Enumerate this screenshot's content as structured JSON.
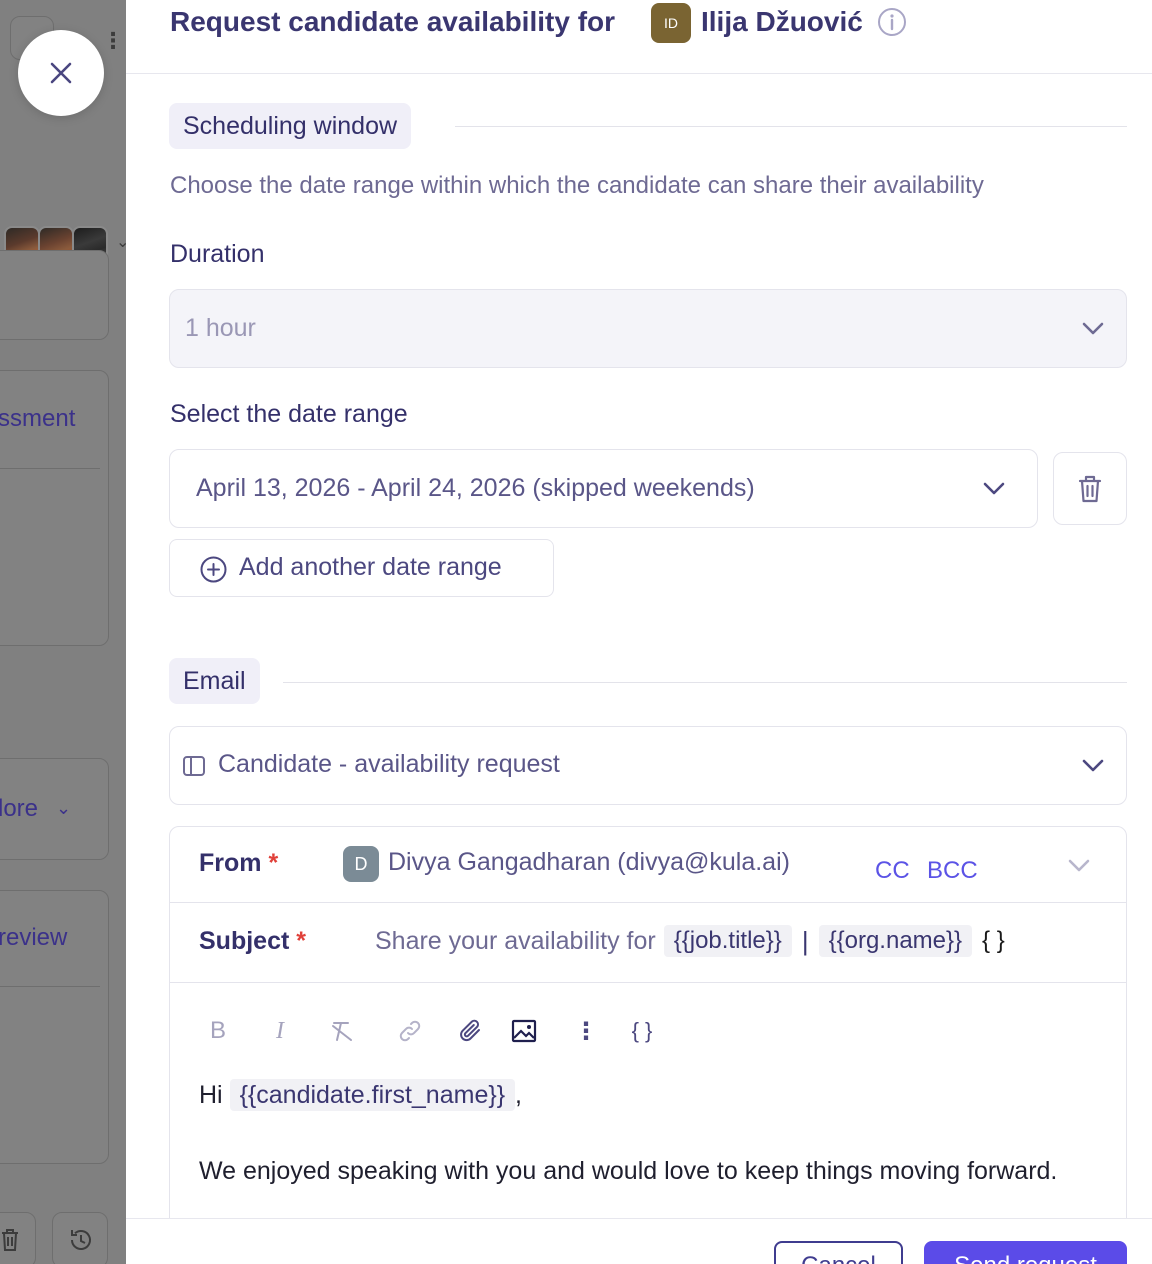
{
  "background": {
    "visible_labels": [
      "ssment",
      "lore",
      "review"
    ]
  },
  "header": {
    "title": "Request candidate availability for",
    "candidate_initials": "ID",
    "candidate_name": "Ilija Džuović"
  },
  "scheduling": {
    "section_label": "Scheduling window",
    "description": "Choose the date range within which the candidate can share their availability",
    "duration_label": "Duration",
    "duration_value": "1 hour",
    "date_range_label": "Select the date range",
    "date_range_value": "April 13, 2026 - April 24, 2026 (skipped weekends)",
    "add_range_label": "Add another date range"
  },
  "email": {
    "section_label": "Email",
    "template_value": "Candidate - availability request",
    "from_label": "From",
    "from_initial": "D",
    "from_value": "Divya Gangadharan (divya@kula.ai)",
    "cc_label": "CC",
    "bcc_label": "BCC",
    "subject_label": "Subject",
    "subject_prefix": "Share your availability for",
    "subject_tag_job": "{{job.title}}",
    "subject_separator": "|",
    "subject_tag_org": "{{org.name}}",
    "subject_braces": "{ }",
    "toolbar": {
      "bold": "B",
      "italic": "I",
      "variables": "{ }"
    },
    "body_greeting": "Hi",
    "body_tag": "{{candidate.first_name}}",
    "body_comma": ",",
    "body_paragraph": "We enjoyed speaking with you and would love to keep things moving forward."
  },
  "footer": {
    "cancel_label": "Cancel",
    "send_label": "Send request"
  },
  "colors": {
    "accent": "#5b4be8",
    "text_primary": "#34306a",
    "required": "#e0413a",
    "cc_link": "#5b53e6"
  }
}
